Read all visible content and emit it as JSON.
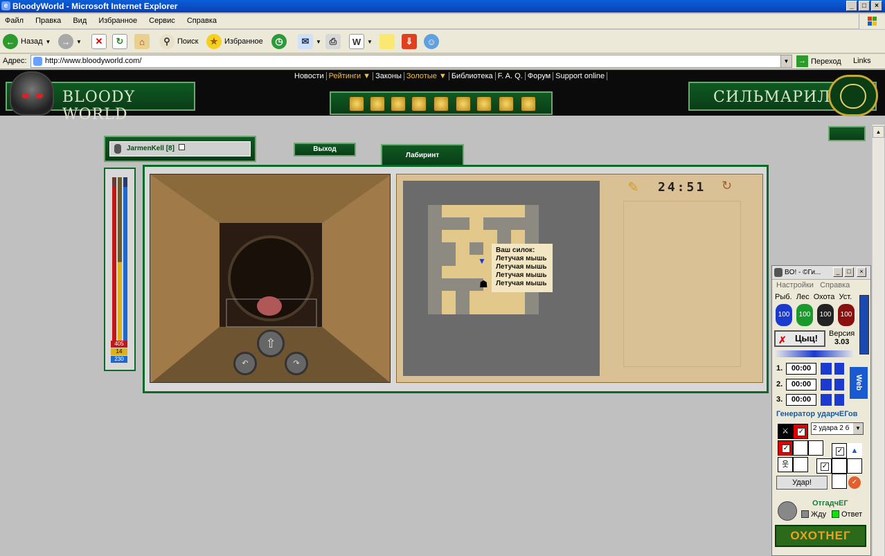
{
  "window": {
    "title": "BloodyWorld - Microsoft Internet Explorer",
    "btn_min": "_",
    "btn_max": "□",
    "btn_close": "×"
  },
  "menu": [
    "Файл",
    "Правка",
    "Вид",
    "Избранное",
    "Сервис",
    "Справка"
  ],
  "toolbar": {
    "back": "Назад",
    "search": "Поиск",
    "favorites": "Избранное"
  },
  "address": {
    "label": "Адрес:",
    "url": "http://www.bloodyworld.com/",
    "go": "Переход",
    "links": "Links"
  },
  "site": {
    "logo_text": "BLOODY WORLD",
    "partner_text": "СИЛЬМАРИЛ",
    "nav": [
      "Новости",
      "Рейтинги ▼",
      "Законы",
      "Золотые ▼",
      "Библиотека",
      "F. A. Q.",
      "Форум",
      "Support online"
    ]
  },
  "game": {
    "username": "JarmenKell [8]",
    "exit": "Выход",
    "tab": "Лабиринт",
    "stats": [
      "405",
      "14",
      "230"
    ],
    "timer": "24:51",
    "tooltip_title": "Ваш силок:",
    "tooltip_items": [
      "Летучая мышь",
      "Летучая мышь",
      "Летучая мышь",
      "Летучая мышь"
    ]
  },
  "bot": {
    "title": "BO! - ©Ги...",
    "menu": [
      "Настройки",
      "Справка"
    ],
    "tabs": [
      "Рыб.",
      "Лес",
      "Охота",
      "Уст."
    ],
    "tank_values": [
      "100",
      "100",
      "100",
      "100"
    ],
    "tsyts": "Цыц!",
    "version_label": "Версия",
    "version": "3.03",
    "rows": [
      "1.",
      "2.",
      "3."
    ],
    "times": [
      "00:00",
      "00:00",
      "00:00"
    ],
    "web": "Web",
    "generator": "Генератор ударчЕГов",
    "strikes_select": "2 удара 2 б",
    "hit": "Удар!",
    "otgad": "ОтгадчЕГ",
    "wait": "Жду",
    "answer": "Ответ",
    "banner": "ОХОТНЕГ"
  },
  "colors": {
    "ie_blue": "#0b3fb5",
    "site_green": "#0a6a28",
    "hp_red": "#c01818",
    "mana_blue": "#1c6ad0",
    "stamina_gold": "#e0b018"
  }
}
